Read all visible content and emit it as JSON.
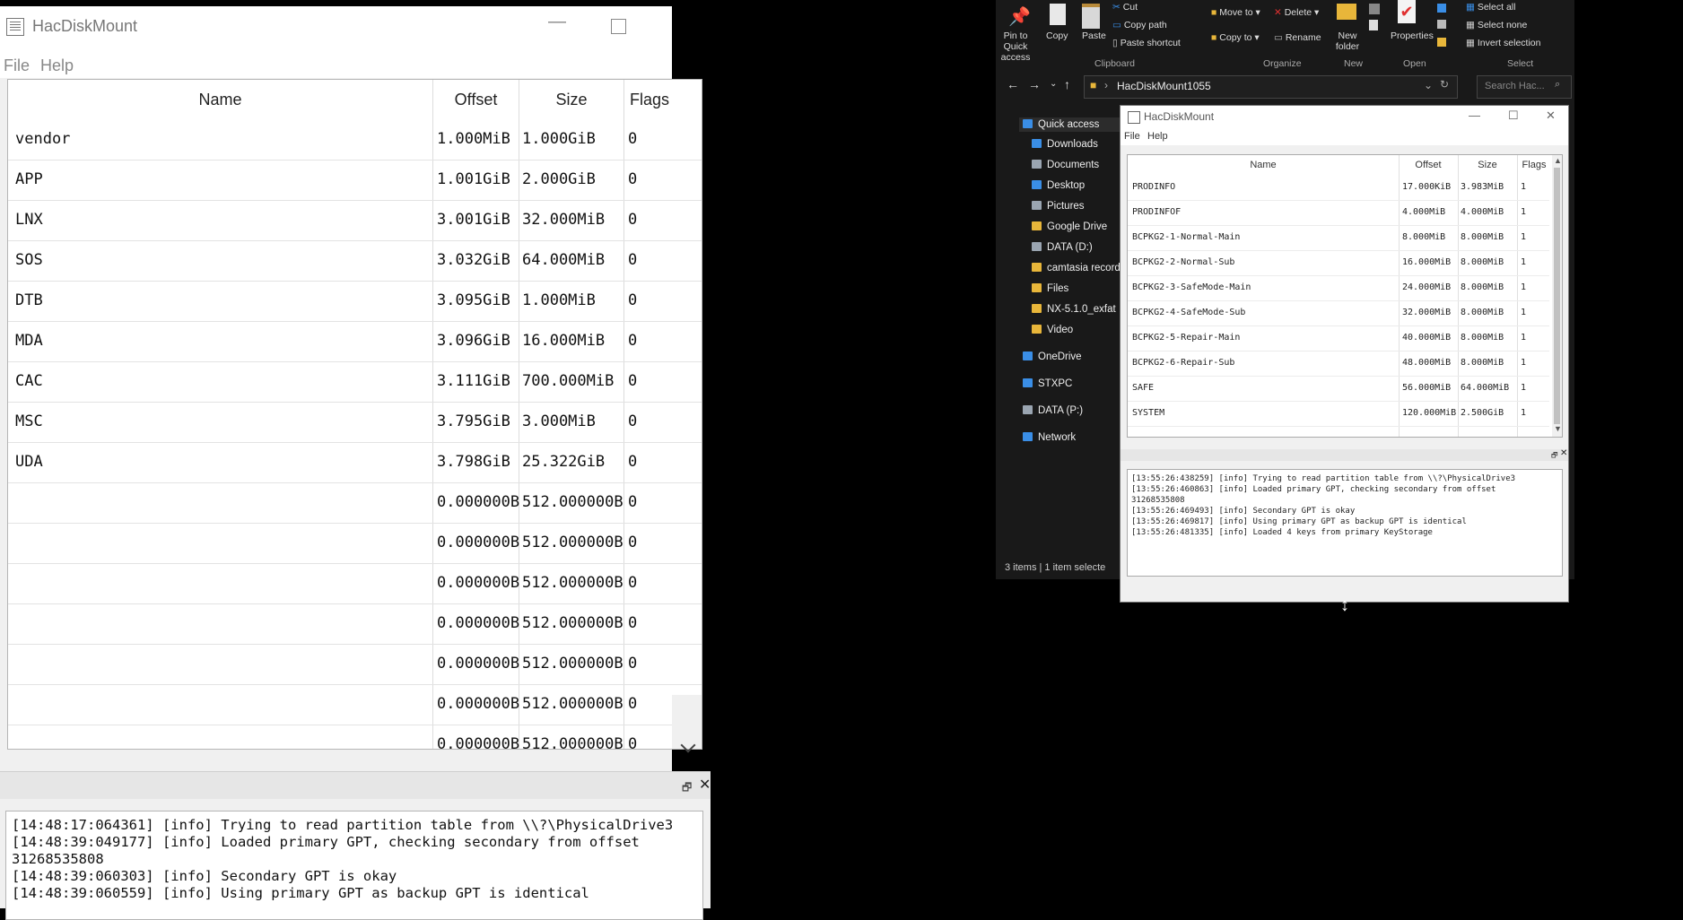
{
  "main_window": {
    "title": "HacDiskMount",
    "menu": [
      "File",
      "Help"
    ],
    "columns": [
      "Name",
      "Offset",
      "Size",
      "Flags"
    ],
    "rows": [
      {
        "name": "vendor",
        "offset": "1.000MiB",
        "size": "1.000GiB",
        "flags": "0"
      },
      {
        "name": "APP",
        "offset": "1.001GiB",
        "size": "2.000GiB",
        "flags": "0"
      },
      {
        "name": "LNX",
        "offset": "3.001GiB",
        "size": "32.000MiB",
        "flags": "0"
      },
      {
        "name": "SOS",
        "offset": "3.032GiB",
        "size": "64.000MiB",
        "flags": "0"
      },
      {
        "name": "DTB",
        "offset": "3.095GiB",
        "size": "1.000MiB",
        "flags": "0"
      },
      {
        "name": "MDA",
        "offset": "3.096GiB",
        "size": "16.000MiB",
        "flags": "0"
      },
      {
        "name": "CAC",
        "offset": "3.111GiB",
        "size": "700.000MiB",
        "flags": "0"
      },
      {
        "name": "MSC",
        "offset": "3.795GiB",
        "size": "3.000MiB",
        "flags": "0"
      },
      {
        "name": "UDA",
        "offset": "3.798GiB",
        "size": "25.322GiB",
        "flags": "0"
      },
      {
        "name": "",
        "offset": "0.000000B",
        "size": "512.000000B",
        "flags": "0"
      },
      {
        "name": "",
        "offset": "0.000000B",
        "size": "512.000000B",
        "flags": "0"
      },
      {
        "name": "",
        "offset": "0.000000B",
        "size": "512.000000B",
        "flags": "0"
      },
      {
        "name": "",
        "offset": "0.000000B",
        "size": "512.000000B",
        "flags": "0"
      },
      {
        "name": "",
        "offset": "0.000000B",
        "size": "512.000000B",
        "flags": "0"
      },
      {
        "name": "",
        "offset": "0.000000B",
        "size": "512.000000B",
        "flags": "0"
      },
      {
        "name": "",
        "offset": "0.000000B",
        "size": "512.000000B",
        "flags": "0"
      }
    ],
    "log": [
      "[14:48:17:064361] [info] Trying to read partition table from \\\\?\\PhysicalDrive3",
      "[14:48:39:049177] [info] Loaded primary GPT, checking secondary from offset",
      "31268535808",
      "[14:48:39:060303] [info] Secondary GPT is okay",
      "[14:48:39:060559] [info] Using primary GPT as backup GPT is identical"
    ]
  },
  "explorer": {
    "ribbon": {
      "pin": "Pin to Quick access",
      "copy": "Copy",
      "paste": "Paste",
      "cut": "Cut",
      "copy_path": "Copy path",
      "paste_shortcut": "Paste shortcut",
      "move_to": "Move to",
      "copy_to": "Copy to",
      "delete": "Delete",
      "rename": "Rename",
      "new_folder": "New folder",
      "properties": "Properties",
      "select_all": "Select all",
      "select_none": "Select none",
      "invert_selection": "Invert selection",
      "groups": [
        "Clipboard",
        "Organize",
        "New",
        "Open",
        "Select"
      ]
    },
    "address": "HacDiskMount1055",
    "search_placeholder": "Search Hac...",
    "nav": [
      {
        "label": "Quick access",
        "color": "#3a8ee6"
      },
      {
        "label": "Downloads",
        "color": "#3a8ee6"
      },
      {
        "label": "Documents",
        "color": "#9aa5b1"
      },
      {
        "label": "Desktop",
        "color": "#3a8ee6"
      },
      {
        "label": "Pictures",
        "color": "#9aa5b1"
      },
      {
        "label": "Google Drive",
        "color": "#e8b63a"
      },
      {
        "label": "DATA (D:)",
        "color": "#9aa5b1"
      },
      {
        "label": "camtasia recorder",
        "color": "#e8b63a"
      },
      {
        "label": "Files",
        "color": "#e8b63a"
      },
      {
        "label": "NX-5.1.0_exfat",
        "color": "#e8b63a"
      },
      {
        "label": "Video",
        "color": "#e8b63a"
      },
      {
        "label": "OneDrive",
        "color": "#3a8ee6"
      },
      {
        "label": "STXPC",
        "color": "#3a8ee6"
      },
      {
        "label": "DATA (P:)",
        "color": "#9aa5b1"
      },
      {
        "label": "Network",
        "color": "#3a8ee6"
      }
    ],
    "status": "3 items  |  1 item selecte"
  },
  "small_window": {
    "title": "HacDiskMount",
    "menu": [
      "File",
      "Help"
    ],
    "columns": [
      "Name",
      "Offset",
      "Size",
      "Flags"
    ],
    "rows": [
      {
        "name": "PRODINFO",
        "offset": "17.000KiB",
        "size": "3.983MiB",
        "flags": "1"
      },
      {
        "name": "PRODINFOF",
        "offset": "4.000MiB",
        "size": "4.000MiB",
        "flags": "1"
      },
      {
        "name": "BCPKG2-1-Normal-Main",
        "offset": "8.000MiB",
        "size": "8.000MiB",
        "flags": "1"
      },
      {
        "name": "BCPKG2-2-Normal-Sub",
        "offset": "16.000MiB",
        "size": "8.000MiB",
        "flags": "1"
      },
      {
        "name": "BCPKG2-3-SafeMode-Main",
        "offset": "24.000MiB",
        "size": "8.000MiB",
        "flags": "1"
      },
      {
        "name": "BCPKG2-4-SafeMode-Sub",
        "offset": "32.000MiB",
        "size": "8.000MiB",
        "flags": "1"
      },
      {
        "name": "BCPKG2-5-Repair-Main",
        "offset": "40.000MiB",
        "size": "8.000MiB",
        "flags": "1"
      },
      {
        "name": "BCPKG2-6-Repair-Sub",
        "offset": "48.000MiB",
        "size": "8.000MiB",
        "flags": "1"
      },
      {
        "name": "SAFE",
        "offset": "56.000MiB",
        "size": "64.000MiB",
        "flags": "1"
      },
      {
        "name": "SYSTEM",
        "offset": "120.000MiB",
        "size": "2.500GiB",
        "flags": "1"
      }
    ],
    "log": [
      "[13:55:26:438259] [info] Trying to read partition table from \\\\?\\PhysicalDrive3",
      "[13:55:26:460863] [info] Loaded primary GPT, checking secondary from offset",
      "31268535808",
      "[13:55:26:469493] [info] Secondary GPT is okay",
      "[13:55:26:469817] [info] Using primary GPT as backup GPT is identical",
      "[13:55:26:481335] [info] Loaded 4 keys from primary KeyStorage"
    ]
  }
}
